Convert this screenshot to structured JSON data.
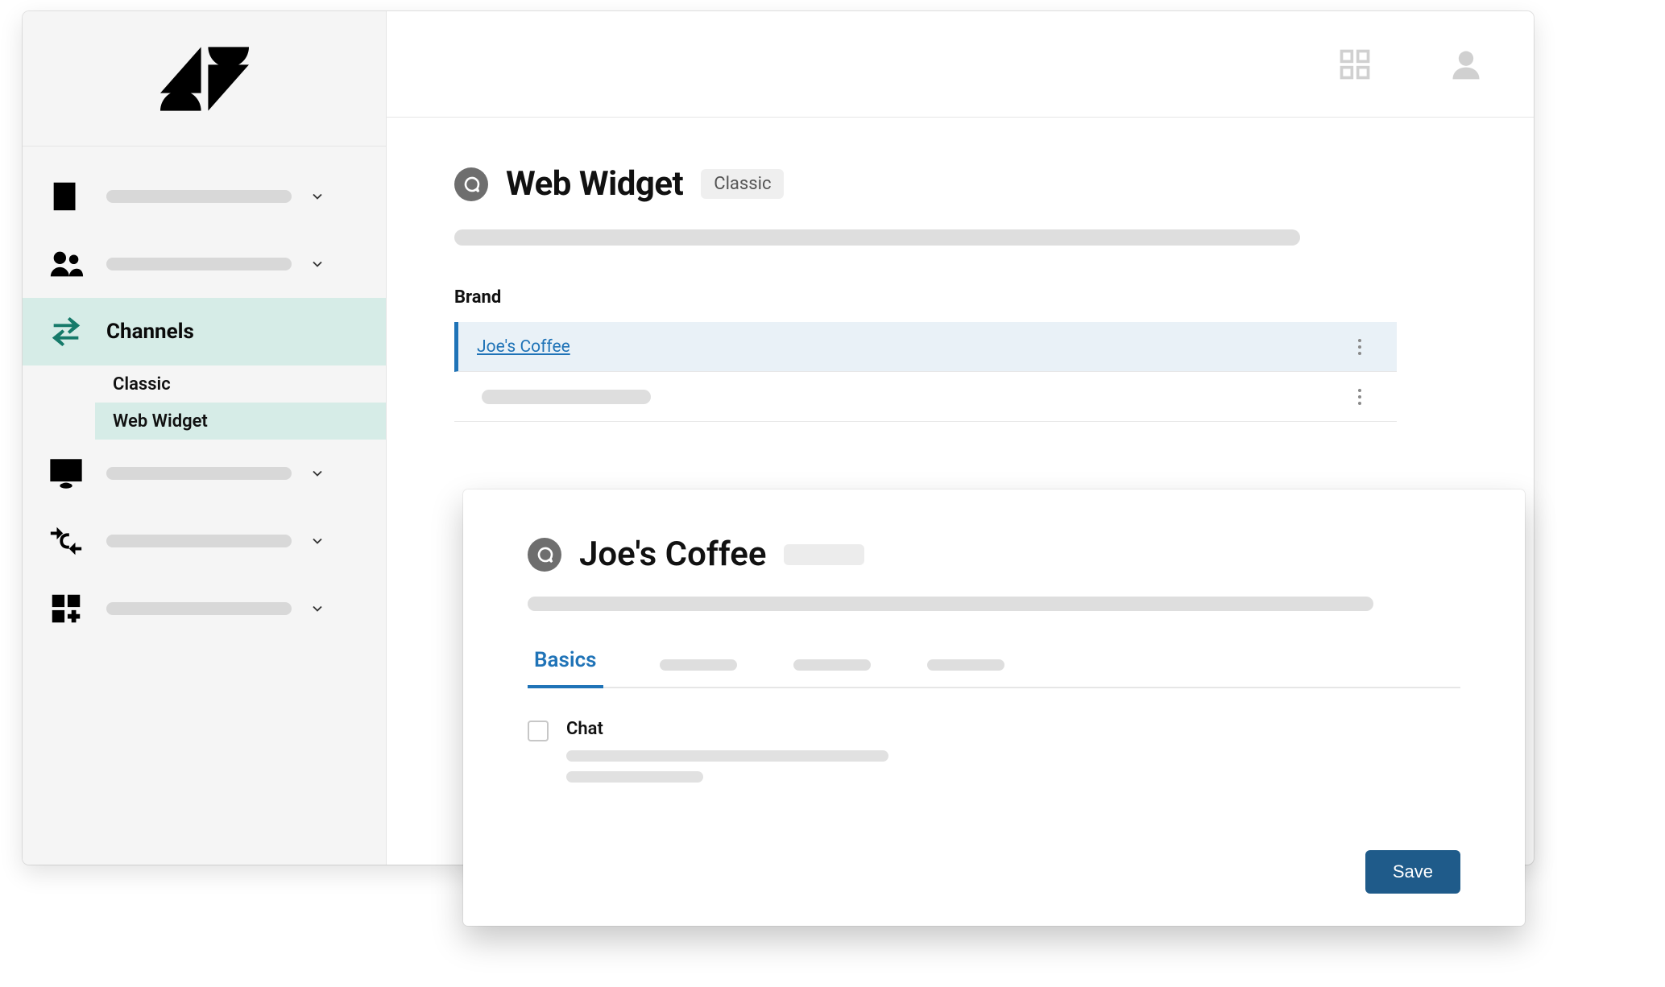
{
  "sidebar": {
    "channels_label": "Channels",
    "sub": {
      "classic": "Classic",
      "web_widget": "Web Widget"
    }
  },
  "topbar": {
    "apps_icon": "apps",
    "user_icon": "user"
  },
  "page": {
    "title": "Web Widget",
    "badge": "Classic",
    "brand_header": "Brand",
    "brand_selected": "Joe's Coffee"
  },
  "overlay": {
    "title": "Joe's Coffee",
    "tab_active": "Basics",
    "option_label": "Chat",
    "save_label": "Save"
  }
}
